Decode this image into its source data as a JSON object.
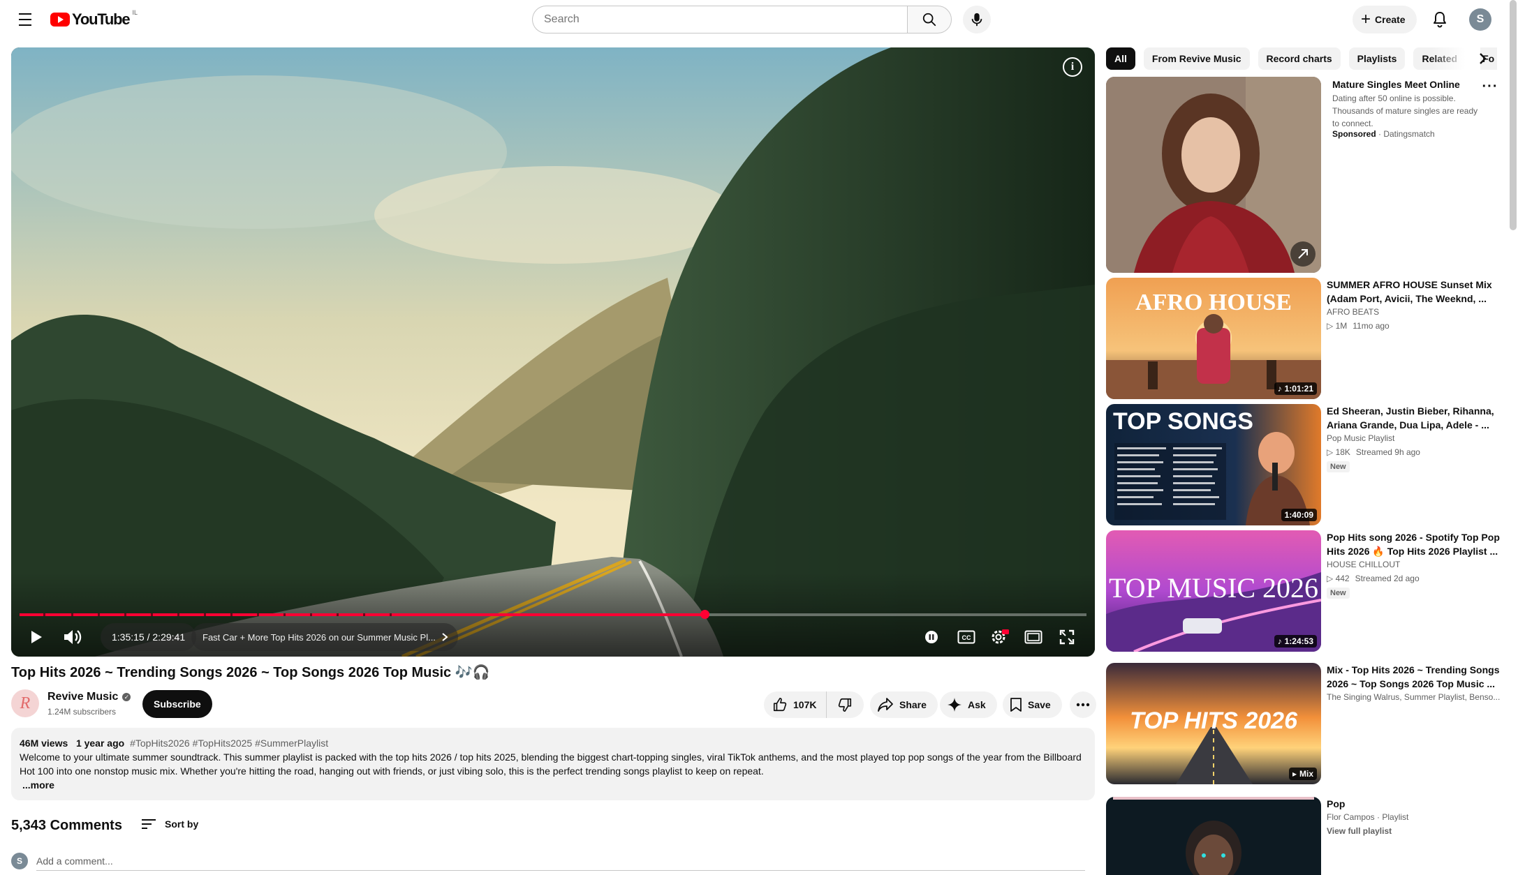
{
  "header": {
    "logo_text": "YouTube",
    "logo_region": "IL",
    "search_placeholder": "Search",
    "create_label": "Create",
    "avatar_initial": "S"
  },
  "player": {
    "current_time": "1:35:15",
    "separator": " / ",
    "duration": "2:29:41",
    "progress_fraction": 0.642,
    "chapter_label": "Fast Car + More Top Hits 2026 on our Summer Music Pl..."
  },
  "video": {
    "title": "Top Hits 2026 ~ Trending Songs 2026 ~ Top Songs 2026 Top Music 🎶🎧",
    "channel_initial": "R",
    "channel_name": "Revive Music",
    "subscribers": "1.24M subscribers",
    "subscribe_label": "Subscribe",
    "like_count": "107K",
    "share_label": "Share",
    "ask_label": "Ask",
    "save_label": "Save"
  },
  "description": {
    "views": "46M views",
    "age": "1 year ago",
    "tags": "#TopHits2026 #TopHits2025 #SummerPlaylist",
    "text": "Welcome to your ultimate summer soundtrack. This summer playlist is packed with the top hits 2026 / top hits 2025, blending the biggest chart-topping singles, viral TikTok anthems, and the most played top pop songs of the year from the Billboard Hot 100 into one nonstop music mix. Whether you're hitting the road, hanging out with friends, or just vibing solo, this is the perfect trending songs playlist to keep on repeat.",
    "more_label": "...more"
  },
  "comments": {
    "count_label": "5,343 Comments",
    "sort_label": "Sort by",
    "avatar_initial": "S",
    "input_placeholder": "Add a comment..."
  },
  "chips": [
    "All",
    "From Revive Music",
    "Record charts",
    "Playlists",
    "Related",
    "Fo"
  ],
  "ad": {
    "title": "Mature Singles Meet Online",
    "description": "Dating after 50 online is possible. Thousands of mature singles are ready to connect.",
    "sponsored_label": "Sponsored",
    "advertiser": "Datingsmatch"
  },
  "recommendations": [
    {
      "title": "SUMMER AFRO HOUSE Sunset Mix (Adam Port, Avicii, The Weeknd, ...",
      "channel": "AFRO BEATS",
      "views": "1M",
      "age": "11mo ago",
      "duration": "1:01:21",
      "thumb_text": "AFRO HOUSE"
    },
    {
      "title": "Ed Sheeran, Justin Bieber, Rihanna, Ariana Grande, Dua Lipa, Adele - ...",
      "channel": "Pop Music Playlist",
      "views": "18K",
      "age": "Streamed 9h ago",
      "badge": "New",
      "duration": "1:40:09",
      "thumb_text": "TOP SONGS"
    },
    {
      "title": "Pop Hits song 2026 - Spotify Top Pop Hits 2026 🔥 Top Hits 2026 Playlist ...",
      "channel": "HOUSE CHILLOUT",
      "views": "442",
      "age": "Streamed 2d ago",
      "badge": "New",
      "duration": "1:24:53",
      "thumb_text": "TOP MUSIC 2026"
    },
    {
      "title": "Mix - Top Hits 2026 ~ Trending Songs 2026 ~ Top Songs 2026 Top Music ...",
      "channel": "The Singing Walrus, Summer Playlist, Benso...",
      "duration": "Mix",
      "thumb_text": "TOP HITS 2026"
    },
    {
      "title": "Pop",
      "channel": "Flor Campos · Playlist",
      "link": "View full playlist"
    }
  ],
  "colors": {
    "brand_red": "#ff0000",
    "progress_red": "#ff0033",
    "text_primary": "#0f0f0f",
    "text_secondary": "#606060",
    "chip_bg": "#f2f2f2"
  }
}
